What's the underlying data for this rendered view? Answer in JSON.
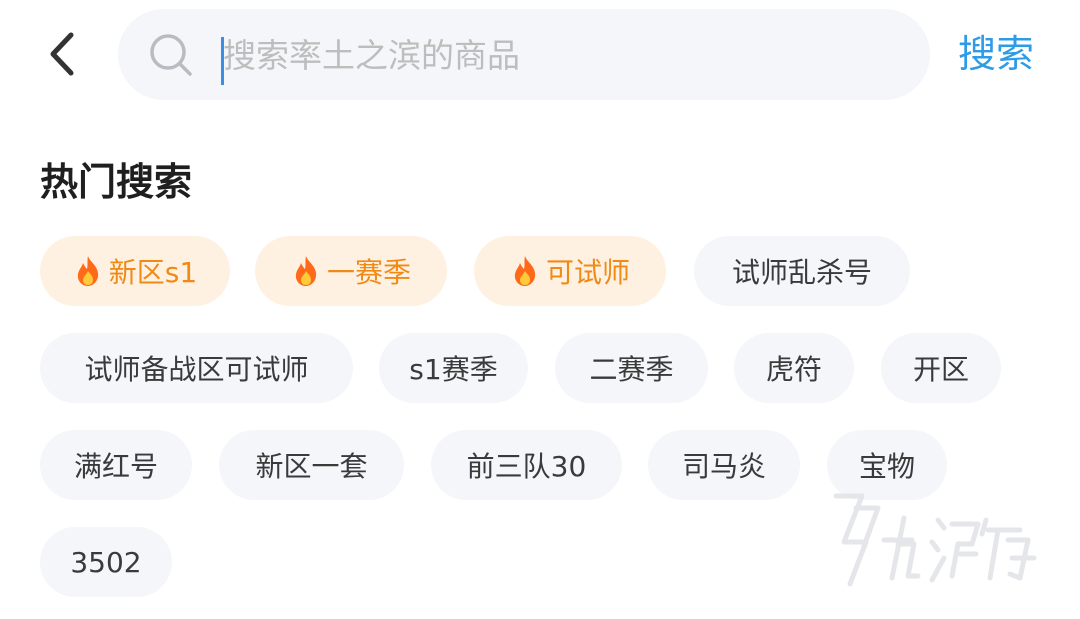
{
  "header": {
    "back_icon": "chevron-left-icon",
    "search_icon": "search-icon",
    "search_placeholder": "搜索率土之滨的商品",
    "search_value": "",
    "search_button": "搜索"
  },
  "hot_section": {
    "title": "热门搜索",
    "tags": [
      {
        "label": "新区s1",
        "hot": true,
        "icon": "fire-icon"
      },
      {
        "label": "一赛季",
        "hot": true,
        "icon": "fire-icon"
      },
      {
        "label": "可试师",
        "hot": true,
        "icon": "fire-icon"
      },
      {
        "label": "试师乱杀号",
        "hot": false
      },
      {
        "label": "试师备战区可试师",
        "hot": false
      },
      {
        "label": "s1赛季",
        "hot": false
      },
      {
        "label": "二赛季",
        "hot": false
      },
      {
        "label": "虎符",
        "hot": false
      },
      {
        "label": "开区",
        "hot": false
      },
      {
        "label": "满红号",
        "hot": false
      },
      {
        "label": "新区一套",
        "hot": false
      },
      {
        "label": "前三队30",
        "hot": false
      },
      {
        "label": "司马炎",
        "hot": false
      },
      {
        "label": "宝物",
        "hot": false
      },
      {
        "label": "3502",
        "hot": false
      }
    ]
  },
  "watermark": {
    "text": "九游",
    "icon": "jiuyou-logo-icon"
  },
  "colors": {
    "accent": "#2e9be6",
    "hot_text": "#f08a17",
    "hot_bg": "#fff1e2",
    "tag_bg": "#f5f6f9"
  }
}
